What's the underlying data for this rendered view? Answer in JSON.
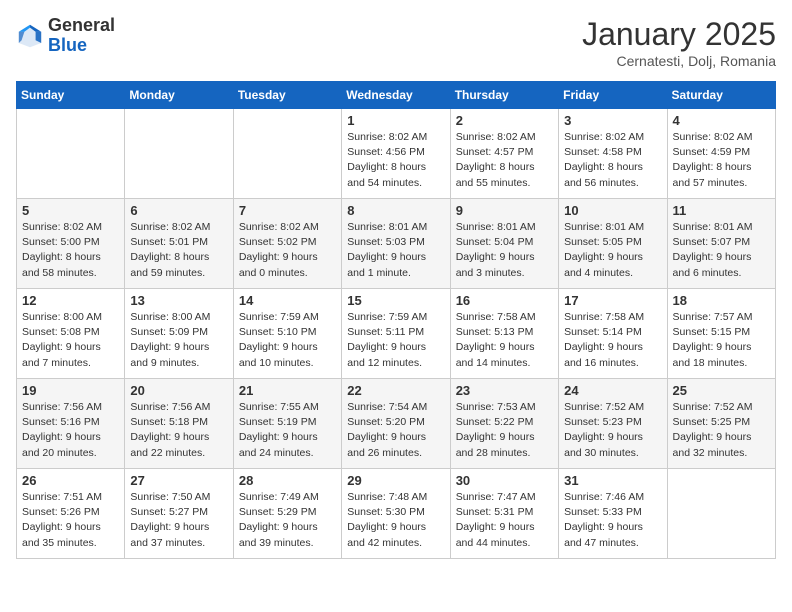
{
  "header": {
    "logo_general": "General",
    "logo_blue": "Blue",
    "month_title": "January 2025",
    "location": "Cernatesti, Dolj, Romania"
  },
  "weekdays": [
    "Sunday",
    "Monday",
    "Tuesday",
    "Wednesday",
    "Thursday",
    "Friday",
    "Saturday"
  ],
  "weeks": [
    [
      {
        "day": "",
        "content": ""
      },
      {
        "day": "",
        "content": ""
      },
      {
        "day": "",
        "content": ""
      },
      {
        "day": "1",
        "content": "Sunrise: 8:02 AM\nSunset: 4:56 PM\nDaylight: 8 hours\nand 54 minutes."
      },
      {
        "day": "2",
        "content": "Sunrise: 8:02 AM\nSunset: 4:57 PM\nDaylight: 8 hours\nand 55 minutes."
      },
      {
        "day": "3",
        "content": "Sunrise: 8:02 AM\nSunset: 4:58 PM\nDaylight: 8 hours\nand 56 minutes."
      },
      {
        "day": "4",
        "content": "Sunrise: 8:02 AM\nSunset: 4:59 PM\nDaylight: 8 hours\nand 57 minutes."
      }
    ],
    [
      {
        "day": "5",
        "content": "Sunrise: 8:02 AM\nSunset: 5:00 PM\nDaylight: 8 hours\nand 58 minutes."
      },
      {
        "day": "6",
        "content": "Sunrise: 8:02 AM\nSunset: 5:01 PM\nDaylight: 8 hours\nand 59 minutes."
      },
      {
        "day": "7",
        "content": "Sunrise: 8:02 AM\nSunset: 5:02 PM\nDaylight: 9 hours\nand 0 minutes."
      },
      {
        "day": "8",
        "content": "Sunrise: 8:01 AM\nSunset: 5:03 PM\nDaylight: 9 hours\nand 1 minute."
      },
      {
        "day": "9",
        "content": "Sunrise: 8:01 AM\nSunset: 5:04 PM\nDaylight: 9 hours\nand 3 minutes."
      },
      {
        "day": "10",
        "content": "Sunrise: 8:01 AM\nSunset: 5:05 PM\nDaylight: 9 hours\nand 4 minutes."
      },
      {
        "day": "11",
        "content": "Sunrise: 8:01 AM\nSunset: 5:07 PM\nDaylight: 9 hours\nand 6 minutes."
      }
    ],
    [
      {
        "day": "12",
        "content": "Sunrise: 8:00 AM\nSunset: 5:08 PM\nDaylight: 9 hours\nand 7 minutes."
      },
      {
        "day": "13",
        "content": "Sunrise: 8:00 AM\nSunset: 5:09 PM\nDaylight: 9 hours\nand 9 minutes."
      },
      {
        "day": "14",
        "content": "Sunrise: 7:59 AM\nSunset: 5:10 PM\nDaylight: 9 hours\nand 10 minutes."
      },
      {
        "day": "15",
        "content": "Sunrise: 7:59 AM\nSunset: 5:11 PM\nDaylight: 9 hours\nand 12 minutes."
      },
      {
        "day": "16",
        "content": "Sunrise: 7:58 AM\nSunset: 5:13 PM\nDaylight: 9 hours\nand 14 minutes."
      },
      {
        "day": "17",
        "content": "Sunrise: 7:58 AM\nSunset: 5:14 PM\nDaylight: 9 hours\nand 16 minutes."
      },
      {
        "day": "18",
        "content": "Sunrise: 7:57 AM\nSunset: 5:15 PM\nDaylight: 9 hours\nand 18 minutes."
      }
    ],
    [
      {
        "day": "19",
        "content": "Sunrise: 7:56 AM\nSunset: 5:16 PM\nDaylight: 9 hours\nand 20 minutes."
      },
      {
        "day": "20",
        "content": "Sunrise: 7:56 AM\nSunset: 5:18 PM\nDaylight: 9 hours\nand 22 minutes."
      },
      {
        "day": "21",
        "content": "Sunrise: 7:55 AM\nSunset: 5:19 PM\nDaylight: 9 hours\nand 24 minutes."
      },
      {
        "day": "22",
        "content": "Sunrise: 7:54 AM\nSunset: 5:20 PM\nDaylight: 9 hours\nand 26 minutes."
      },
      {
        "day": "23",
        "content": "Sunrise: 7:53 AM\nSunset: 5:22 PM\nDaylight: 9 hours\nand 28 minutes."
      },
      {
        "day": "24",
        "content": "Sunrise: 7:52 AM\nSunset: 5:23 PM\nDaylight: 9 hours\nand 30 minutes."
      },
      {
        "day": "25",
        "content": "Sunrise: 7:52 AM\nSunset: 5:25 PM\nDaylight: 9 hours\nand 32 minutes."
      }
    ],
    [
      {
        "day": "26",
        "content": "Sunrise: 7:51 AM\nSunset: 5:26 PM\nDaylight: 9 hours\nand 35 minutes."
      },
      {
        "day": "27",
        "content": "Sunrise: 7:50 AM\nSunset: 5:27 PM\nDaylight: 9 hours\nand 37 minutes."
      },
      {
        "day": "28",
        "content": "Sunrise: 7:49 AM\nSunset: 5:29 PM\nDaylight: 9 hours\nand 39 minutes."
      },
      {
        "day": "29",
        "content": "Sunrise: 7:48 AM\nSunset: 5:30 PM\nDaylight: 9 hours\nand 42 minutes."
      },
      {
        "day": "30",
        "content": "Sunrise: 7:47 AM\nSunset: 5:31 PM\nDaylight: 9 hours\nand 44 minutes."
      },
      {
        "day": "31",
        "content": "Sunrise: 7:46 AM\nSunset: 5:33 PM\nDaylight: 9 hours\nand 47 minutes."
      },
      {
        "day": "",
        "content": ""
      }
    ]
  ]
}
